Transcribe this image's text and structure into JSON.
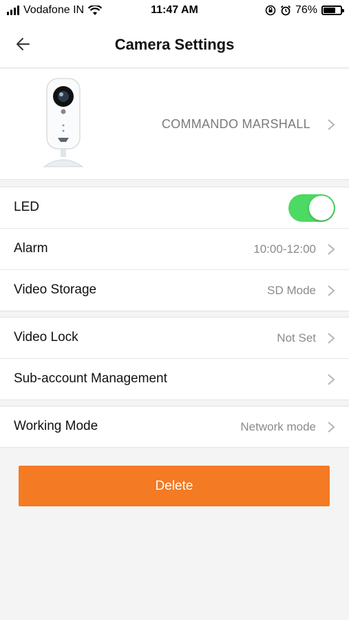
{
  "status_bar": {
    "carrier": "Vodafone IN",
    "time": "11:47 AM",
    "battery": "76%",
    "battery_level": 0.76,
    "icons": [
      "signal-icon",
      "wifi-icon",
      "rotation-lock-icon",
      "alarm-icon",
      "battery-icon"
    ]
  },
  "nav": {
    "title": "Camera Settings",
    "back_icon": "back-arrow-icon"
  },
  "device": {
    "name": "COMMANDO MARSHALL",
    "image": "security-camera-image"
  },
  "settings": {
    "group1": [
      {
        "label": "LED",
        "type": "toggle",
        "on": true
      },
      {
        "label": "Alarm",
        "value": "10:00-12:00"
      },
      {
        "label": "Video Storage",
        "value": "SD Mode"
      }
    ],
    "group2": [
      {
        "label": "Video Lock",
        "value": "Not Set"
      },
      {
        "label": "Sub-account Management",
        "value": ""
      }
    ],
    "group3": [
      {
        "label": "Working Mode",
        "value": "Network mode"
      }
    ]
  },
  "actions": {
    "delete_label": "Delete"
  },
  "colors": {
    "accent": "#f47a23",
    "toggle_on": "#4cd964",
    "background": "#f4f4f4"
  }
}
